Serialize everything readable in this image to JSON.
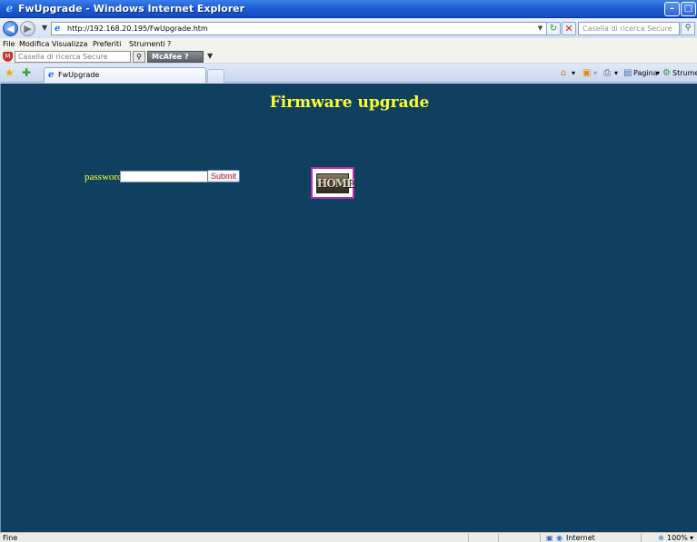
{
  "window": {
    "title": "FwUpgrade - Windows Internet Explorer"
  },
  "address": {
    "url": "http://192.168.20.195/FwUpgrade.htm",
    "search_placeholder": "Casella di ricerca Secure"
  },
  "menu": {
    "items": [
      "File",
      "Modifica",
      "Visualizza",
      "Preferiti",
      "Strumenti",
      "?"
    ]
  },
  "toolbar": {
    "secure_search_placeholder": "Casella di ricerca Secure",
    "mcafee_label": "McAfee"
  },
  "tab": {
    "label": "FwUpgrade"
  },
  "commands": {
    "pagina": "Pagina",
    "strumenti": "Strumenti"
  },
  "page": {
    "title": "Firmware upgrade",
    "password_label": "password:",
    "password_value": "",
    "submit_label": "Submit",
    "home_image_text": "HOME"
  },
  "status": {
    "left": "Fine",
    "zone": "Internet",
    "zoom": "100%"
  },
  "colors": {
    "page_bg": "#0f4060",
    "title": "#ffff33",
    "submit_text": "#c01818",
    "home_border": "#b42eab"
  }
}
